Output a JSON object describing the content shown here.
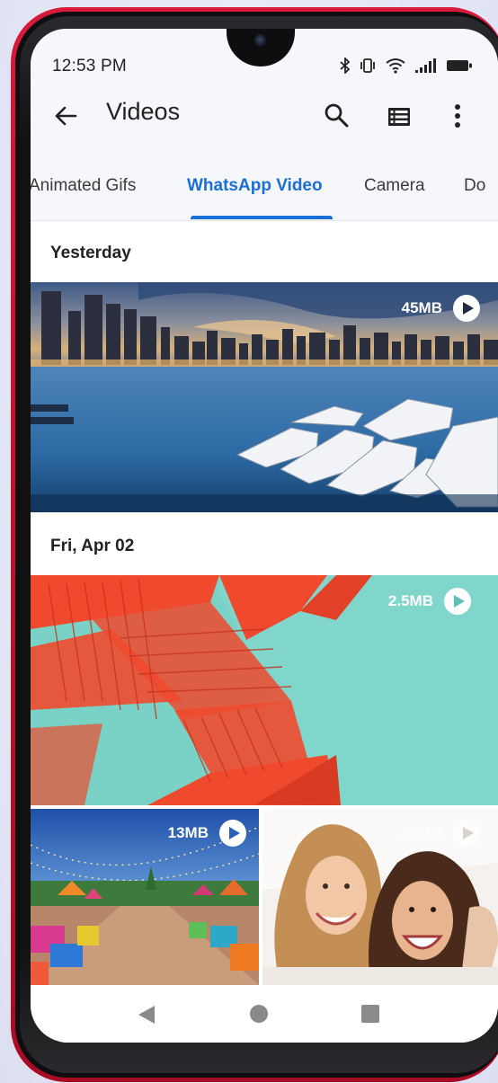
{
  "status_bar": {
    "time": "12:53 PM",
    "icons": [
      "bluetooth-icon",
      "vibrate-icon",
      "wifi-icon",
      "signal-icon",
      "battery-icon"
    ]
  },
  "app_bar": {
    "title": "Videos",
    "back_icon": "arrow-left-icon",
    "actions": [
      "search-icon",
      "list-view-icon",
      "more-vert-icon"
    ]
  },
  "tabs": [
    {
      "label": "Animated Gifs",
      "active": false
    },
    {
      "label": "WhatsApp Video",
      "active": true
    },
    {
      "label": "Camera",
      "active": false
    },
    {
      "label": "Do",
      "active": false
    }
  ],
  "sections": [
    {
      "header": "Yesterday",
      "videos": [
        {
          "size": "45MB",
          "subject": "city-marina"
        }
      ]
    },
    {
      "header": "Fri, Apr 02",
      "videos": [
        {
          "size": "2.5MB",
          "subject": "red-staircase"
        },
        {
          "size": "13MB",
          "subject": "festive-plaza"
        },
        {
          "size": "37MB",
          "subject": "two-women-selfie"
        }
      ]
    }
  ],
  "nav_bar": [
    "nav-back-icon",
    "nav-home-icon",
    "nav-recents-icon"
  ],
  "colors": {
    "accent": "#1a6fd6",
    "phone_frame": "#c8102e",
    "header_bg": "#f6f7fb"
  }
}
